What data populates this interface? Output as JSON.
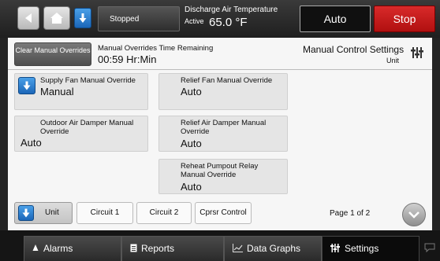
{
  "topbar": {
    "status": "Stopped",
    "discharge_label": "Discharge Air Temperature",
    "discharge_sub": "Active",
    "discharge_value": "65.0 °F",
    "auto_label": "Auto",
    "stop_label": "Stop",
    "stop_color": "#c81c1c"
  },
  "header": {
    "clear_button": "Clear Manual Overrides",
    "override_label": "Manual Overrides Time Remaining",
    "override_value": "00:59 Hr:Min",
    "title": "Manual Control Settings",
    "subtitle": "Unit"
  },
  "cards": {
    "supply_fan": {
      "label": "Supply Fan Manual Override",
      "value": "Manual"
    },
    "relief_fan": {
      "label": "Relief Fan Manual Override",
      "value": "Auto"
    },
    "outdoor_damper": {
      "label": "Outdoor Air Damper Manual Override",
      "value": "Auto"
    },
    "relief_damper": {
      "label": "Relief Air Damper Manual Override",
      "value": "Auto"
    },
    "reheat_pumpout": {
      "label": "Reheat Pumpout Relay Manual Override",
      "value": "Auto"
    }
  },
  "tabs": {
    "unit": "Unit",
    "circuit1": "Circuit 1",
    "circuit2": "Circuit 2",
    "cprsr": "Cprsr Control"
  },
  "page_info": "Page 1 of 2",
  "nav": {
    "alarms": "Alarms",
    "reports": "Reports",
    "data_graphs": "Data Graphs",
    "settings": "Settings"
  },
  "colors": {
    "accent_blue": "#2a7fd4",
    "panel_bg": "#f6f6f6"
  }
}
